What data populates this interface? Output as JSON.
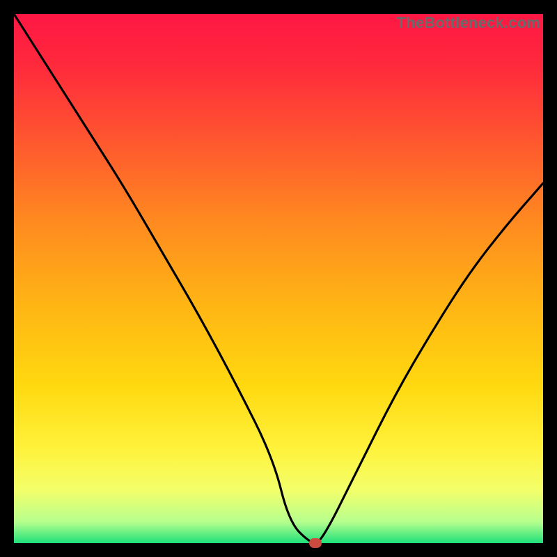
{
  "watermark": "TheBottleneck.com",
  "chart_data": {
    "type": "line",
    "title": "",
    "xlabel": "",
    "ylabel": "",
    "xlim": [
      0,
      100
    ],
    "ylim": [
      0,
      100
    ],
    "grid": false,
    "legend": false,
    "series": [
      {
        "name": "bottleneck-curve",
        "x": [
          0,
          7,
          14,
          21,
          28,
          35,
          42,
          49,
          52,
          56,
          58,
          65,
          72,
          79,
          86,
          93,
          100
        ],
        "y": [
          100,
          89,
          78,
          67,
          55,
          43,
          30,
          16,
          4,
          0,
          0,
          14,
          28,
          40,
          51,
          60,
          68
        ]
      }
    ],
    "gradient_stops": [
      {
        "offset": 0.0,
        "color": "#ff1744"
      },
      {
        "offset": 0.1,
        "color": "#ff2a3c"
      },
      {
        "offset": 0.25,
        "color": "#ff5a2e"
      },
      {
        "offset": 0.4,
        "color": "#ff8c1f"
      },
      {
        "offset": 0.55,
        "color": "#ffb514"
      },
      {
        "offset": 0.7,
        "color": "#ffd80f"
      },
      {
        "offset": 0.82,
        "color": "#fff23a"
      },
      {
        "offset": 0.9,
        "color": "#f3ff6a"
      },
      {
        "offset": 0.96,
        "color": "#b6ff8e"
      },
      {
        "offset": 1.0,
        "color": "#1fe07a"
      }
    ],
    "marker": {
      "x": 57,
      "y": 0,
      "color": "#cc4b3f"
    }
  }
}
